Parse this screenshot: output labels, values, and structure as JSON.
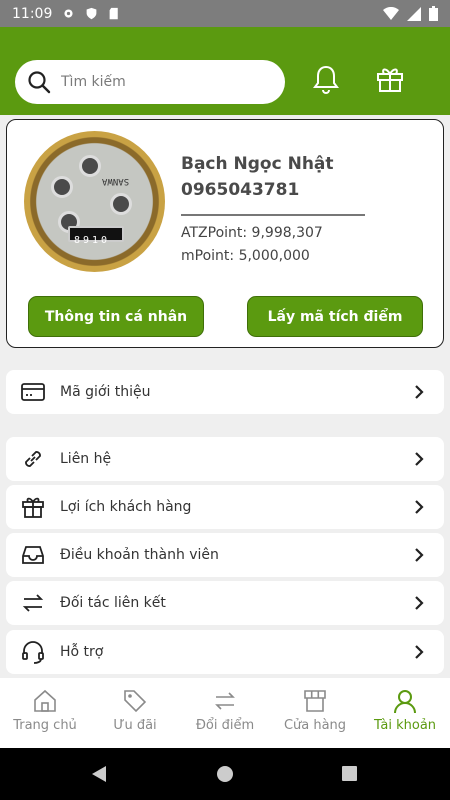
{
  "status_bar": {
    "time": "11:09"
  },
  "search": {
    "placeholder": "Tìm kiếm"
  },
  "profile": {
    "name": "Bạch Ngọc Nhật",
    "phone": "0965043781",
    "atz_point": "ATZPoint: 9,998,307",
    "m_point": "mPoint: 5,000,000",
    "meter_brand": "SANWA",
    "meter_counter": "8910",
    "btn_info": "Thông tin cá nhân",
    "btn_code": "Lấy mã tích điểm"
  },
  "menu": [
    {
      "label": "Mã giới thiệu",
      "icon": "card-icon"
    },
    {
      "label": "Liên hệ",
      "icon": "link-icon"
    },
    {
      "label": "Lợi ích khách hàng",
      "icon": "gift-icon"
    },
    {
      "label": "Điều khoản thành viên",
      "icon": "inbox-icon"
    },
    {
      "label": "Đối tác liên kết",
      "icon": "swap-icon"
    },
    {
      "label": "Hỗ trợ",
      "icon": "headset-icon"
    }
  ],
  "nav": [
    {
      "label": "Trang chủ",
      "icon": "home-icon",
      "active": false
    },
    {
      "label": "Ưu đãi",
      "icon": "tag-icon",
      "active": false
    },
    {
      "label": "Đổi điểm",
      "icon": "swap-icon",
      "active": false
    },
    {
      "label": "Cửa hàng",
      "icon": "store-icon",
      "active": false
    },
    {
      "label": "Tài khoản",
      "icon": "user-icon",
      "active": true
    }
  ],
  "colors": {
    "accent": "#5b9a10",
    "status_bar": "#7d7d7d"
  }
}
